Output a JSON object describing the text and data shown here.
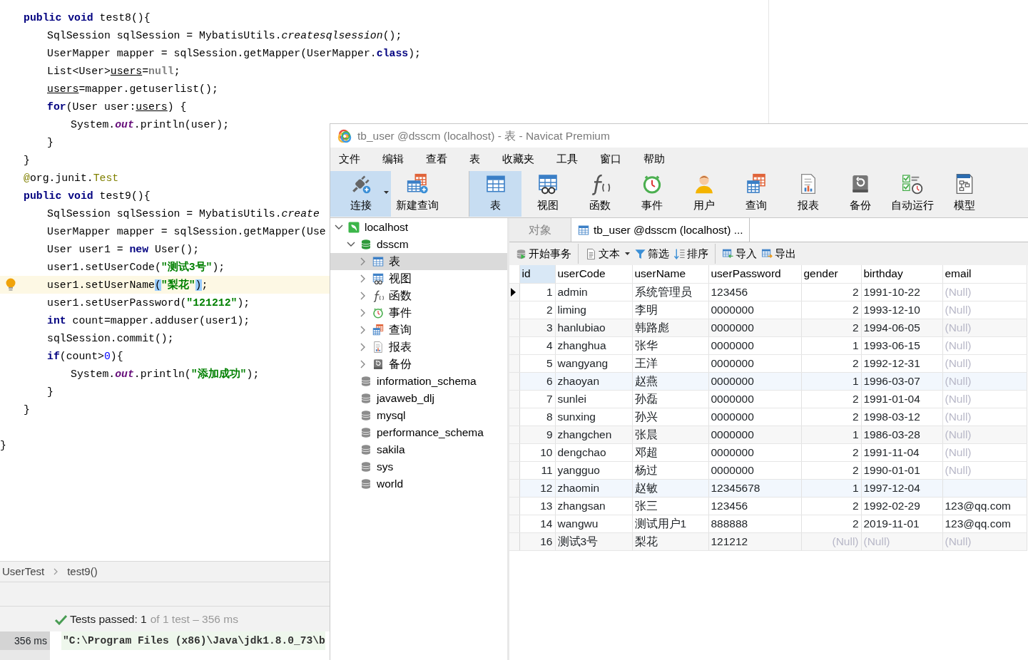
{
  "editor": {
    "lines": [
      {
        "children": [
          {
            "current": false,
            "tokens": [
              {
                "kind": "keyword",
                "text": "public void"
              },
              {
                "kind": "plain",
                "text": " test8(){"
              }
            ],
            "children": [
              {
                "current": false,
                "tokens": [
                  {
                    "kind": "plain",
                    "text": "SqlSession sqlSession = MybatisUtils."
                  },
                  {
                    "kind": "italic",
                    "text": "createsqlsession"
                  },
                  {
                    "kind": "plain",
                    "text": "();"
                  }
                ]
              },
              {
                "current": false,
                "tokens": [
                  {
                    "kind": "plain",
                    "text": "UserMapper mapper = sqlSession.getMapper(UserMapper."
                  },
                  {
                    "kind": "keyword",
                    "text": "class"
                  },
                  {
                    "kind": "plain",
                    "text": ");"
                  }
                ]
              },
              {
                "current": false,
                "tokens": [
                  {
                    "kind": "plain",
                    "text": "List<User>"
                  },
                  {
                    "kind": "var",
                    "text": "users"
                  },
                  {
                    "kind": "plain",
                    "text": "="
                  },
                  {
                    "kind": "null",
                    "text": "null"
                  },
                  {
                    "kind": "plain",
                    "text": ";"
                  }
                ]
              },
              {
                "current": false,
                "tokens": [
                  {
                    "kind": "var",
                    "text": "users"
                  },
                  {
                    "kind": "plain",
                    "text": "=mapper.getuserlist();"
                  }
                ]
              },
              {
                "current": false,
                "tokens": [
                  {
                    "kind": "keyword",
                    "text": "for"
                  },
                  {
                    "kind": "plain",
                    "text": "(User user:"
                  },
                  {
                    "kind": "var",
                    "text": "users"
                  },
                  {
                    "kind": "plain",
                    "text": ") {"
                  }
                ],
                "children": [
                  {
                    "current": false,
                    "tokens": [
                      {
                        "kind": "plain",
                        "text": "System."
                      },
                      {
                        "kind": "field",
                        "text": "out"
                      },
                      {
                        "kind": "plain",
                        "text": ".println(user);"
                      }
                    ]
                  }
                ]
              },
              {
                "current": false,
                "tokens": [
                  {
                    "kind": "plain",
                    "text": "}"
                  }
                ]
              }
            ]
          },
          {
            "current": false,
            "tokens": [
              {
                "kind": "plain",
                "text": "}"
              }
            ]
          },
          {
            "current": false,
            "tokens": [
              {
                "kind": "type",
                "text": "@"
              },
              {
                "kind": "plain",
                "text": "org.junit."
              },
              {
                "kind": "type",
                "text": "Test"
              }
            ]
          },
          {
            "current": false,
            "tokens": [
              {
                "kind": "keyword",
                "text": "public void"
              },
              {
                "kind": "plain",
                "text": " test9(){"
              }
            ],
            "children": [
              {
                "current": false,
                "tokens": [
                  {
                    "kind": "plain",
                    "text": "SqlSession sqlSession = MybatisUtils."
                  },
                  {
                    "kind": "italic",
                    "text": "create"
                  }
                ]
              },
              {
                "current": false,
                "tokens": [
                  {
                    "kind": "plain",
                    "text": "UserMapper mapper = sqlSession.getMapper(Use"
                  }
                ]
              },
              {
                "current": false,
                "tokens": [
                  {
                    "kind": "plain",
                    "text": "User user1 = "
                  },
                  {
                    "kind": "keyword",
                    "text": "new"
                  },
                  {
                    "kind": "plain",
                    "text": " User();"
                  }
                ]
              },
              {
                "current": false,
                "tokens": [
                  {
                    "kind": "plain",
                    "text": "user1.setUserCode("
                  },
                  {
                    "kind": "string",
                    "text": "\"测试3号\""
                  },
                  {
                    "kind": "plain",
                    "text": ");"
                  }
                ]
              },
              {
                "current": true,
                "tokens": [
                  {
                    "kind": "plain",
                    "text": "user1.setUserName"
                  },
                  {
                    "kind": "match",
                    "text": "("
                  },
                  {
                    "kind": "string",
                    "text": "\"梨花\""
                  },
                  {
                    "kind": "match",
                    "text": ")"
                  },
                  {
                    "kind": "plain",
                    "text": ";"
                  }
                ]
              },
              {
                "current": false,
                "tokens": [
                  {
                    "kind": "plain",
                    "text": "user1.setUserPassword("
                  },
                  {
                    "kind": "string",
                    "text": "\"121212\""
                  },
                  {
                    "kind": "plain",
                    "text": ");"
                  }
                ]
              },
              {
                "current": false,
                "tokens": [
                  {
                    "kind": "keyword",
                    "text": "int"
                  },
                  {
                    "kind": "plain",
                    "text": " count=mapper.adduser(user1);"
                  }
                ]
              },
              {
                "current": false,
                "tokens": [
                  {
                    "kind": "plain",
                    "text": "sqlSession.commit();"
                  }
                ]
              },
              {
                "current": false,
                "tokens": [
                  {
                    "kind": "keyword",
                    "text": "if"
                  },
                  {
                    "kind": "plain",
                    "text": "(count>"
                  },
                  {
                    "kind": "number",
                    "text": "0"
                  },
                  {
                    "kind": "plain",
                    "text": "){"
                  }
                ],
                "children": [
                  {
                    "current": false,
                    "tokens": [
                      {
                        "kind": "plain",
                        "text": "System."
                      },
                      {
                        "kind": "field",
                        "text": "out"
                      },
                      {
                        "kind": "plain",
                        "text": ".println("
                      },
                      {
                        "kind": "string",
                        "text": "\"添加成功\""
                      },
                      {
                        "kind": "plain",
                        "text": ");"
                      }
                    ]
                  }
                ]
              },
              {
                "current": false,
                "tokens": [
                  {
                    "kind": "plain",
                    "text": "}"
                  }
                ]
              }
            ]
          },
          {
            "current": false,
            "tokens": [
              {
                "kind": "plain",
                "text": "}"
              }
            ]
          }
        ]
      },
      {
        "current": false,
        "gap_before": true,
        "tokens": [
          {
            "kind": "plain",
            "text": "}"
          }
        ]
      }
    ]
  },
  "breadcrumbs": [
    "UserTest",
    "test9()"
  ],
  "test_status": {
    "passed": true,
    "summary": "Tests passed: 1",
    "detail": "of 1 test – 356 ms"
  },
  "console": {
    "duration": "356 ms",
    "output": "\"C:\\Program Files (x86)\\Java\\jdk1.8.0_73\\b"
  },
  "navicat": {
    "title": "tb_user @dsscm (localhost) - 表 - Navicat Premium",
    "menu": [
      "文件",
      "编辑",
      "查看",
      "表",
      "收藏夹",
      "工具",
      "窗口",
      "帮助"
    ],
    "toolbar": [
      {
        "kind": "connect",
        "label": "连接",
        "selected": true,
        "dropdown": true
      },
      {
        "kind": "new_query",
        "label": "新建查询",
        "selected": false
      },
      {
        "kind": "table",
        "label": "表",
        "selected": true,
        "separator_before": true
      },
      {
        "kind": "view",
        "label": "视图",
        "selected": false
      },
      {
        "kind": "function",
        "label": "函数",
        "selected": false
      },
      {
        "kind": "event",
        "label": "事件",
        "selected": false
      },
      {
        "kind": "user",
        "label": "用户",
        "selected": false
      },
      {
        "kind": "query",
        "label": "查询",
        "selected": false
      },
      {
        "kind": "report",
        "label": "报表",
        "selected": false
      },
      {
        "kind": "backup",
        "label": "备份",
        "selected": false
      },
      {
        "kind": "automation",
        "label": "自动运行",
        "selected": false
      },
      {
        "kind": "model",
        "label": "模型",
        "selected": false
      }
    ],
    "tree": [
      {
        "kind": "server",
        "label": "localhost",
        "expanded": true,
        "selected": false,
        "children": [
          {
            "kind": "database_open",
            "label": "dsscm",
            "expanded": true,
            "selected": false,
            "children": [
              {
                "kind": "table",
                "label": "表",
                "expanded": false,
                "selected": true
              },
              {
                "kind": "view",
                "label": "视图",
                "expanded": false,
                "selected": false
              },
              {
                "kind": "function",
                "label": "函数",
                "expanded": false,
                "selected": false
              },
              {
                "kind": "event",
                "label": "事件",
                "expanded": false,
                "selected": false
              },
              {
                "kind": "query",
                "label": "查询",
                "expanded": false,
                "selected": false
              },
              {
                "kind": "report",
                "label": "报表",
                "expanded": false,
                "selected": false
              },
              {
                "kind": "backup",
                "label": "备份",
                "expanded": false,
                "selected": false
              }
            ]
          },
          {
            "kind": "database",
            "label": "information_schema",
            "selected": false
          },
          {
            "kind": "database",
            "label": "javaweb_dlj",
            "selected": false
          },
          {
            "kind": "database",
            "label": "mysql",
            "selected": false
          },
          {
            "kind": "database",
            "label": "performance_schema",
            "selected": false
          },
          {
            "kind": "database",
            "label": "sakila",
            "selected": false
          },
          {
            "kind": "database",
            "label": "sys",
            "selected": false
          },
          {
            "kind": "database",
            "label": "world",
            "selected": false
          }
        ]
      }
    ],
    "tabs": [
      {
        "kind": "objects",
        "label": "对象",
        "selected": false
      },
      {
        "kind": "table",
        "label": "tb_user @dsscm (localhost) ...",
        "selected": true
      }
    ],
    "table_toolbar": [
      {
        "kind": "transaction",
        "label": "开始事务"
      },
      {
        "kind": "text",
        "label": "文本",
        "dropdown": true,
        "separator_before": true
      },
      {
        "kind": "filter",
        "label": "筛选"
      },
      {
        "kind": "sort",
        "label": "排序"
      },
      {
        "kind": "import",
        "label": "导入",
        "separator_before": true
      },
      {
        "kind": "export",
        "label": "导出"
      }
    ],
    "table": {
      "columns": [
        "id",
        "userCode",
        "userName",
        "userPassword",
        "gender",
        "birthday",
        "email"
      ],
      "rows": [
        {
          "current": true,
          "cells": [
            "1",
            "admin",
            "系统管理员",
            "123456",
            "2",
            "1991-10-22",
            {
              "text": "(Null)",
              "null": true
            }
          ]
        },
        {
          "current": false,
          "cells": [
            "2",
            "liming",
            "李明",
            "0000000",
            "2",
            "1993-12-10",
            {
              "text": "(Null)",
              "null": true
            }
          ]
        },
        {
          "current": false,
          "cells": [
            "3",
            "hanlubiao",
            "韩路彪",
            "0000000",
            "2",
            "1994-06-05",
            {
              "text": "(Null)",
              "null": true
            }
          ]
        },
        {
          "current": false,
          "cells": [
            "4",
            "zhanghua",
            "张华",
            "0000000",
            "1",
            "1993-06-15",
            {
              "text": "(Null)",
              "null": true
            }
          ]
        },
        {
          "current": false,
          "cells": [
            "5",
            "wangyang",
            "王洋",
            "0000000",
            "2",
            "1992-12-31",
            {
              "text": "(Null)",
              "null": true
            }
          ]
        },
        {
          "current": false,
          "cells": [
            "6",
            "zhaoyan",
            "赵燕",
            "0000000",
            "1",
            "1996-03-07",
            {
              "text": "(Null)",
              "null": true
            }
          ]
        },
        {
          "current": false,
          "cells": [
            "7",
            "sunlei",
            "孙磊",
            "0000000",
            "2",
            "1991-01-04",
            {
              "text": "(Null)",
              "null": true
            }
          ]
        },
        {
          "current": false,
          "cells": [
            "8",
            "sunxing",
            "孙兴",
            "0000000",
            "2",
            "1998-03-12",
            {
              "text": "(Null)",
              "null": true
            }
          ]
        },
        {
          "current": false,
          "cells": [
            "9",
            "zhangchen",
            "张晨",
            "0000000",
            "1",
            "1986-03-28",
            {
              "text": "(Null)",
              "null": true
            }
          ]
        },
        {
          "current": false,
          "cells": [
            "10",
            "dengchao",
            "邓超",
            "0000000",
            "2",
            "1991-11-04",
            {
              "text": "(Null)",
              "null": true
            }
          ]
        },
        {
          "current": false,
          "cells": [
            "11",
            "yangguo",
            "杨过",
            "0000000",
            "2",
            "1990-01-01",
            {
              "text": "(Null)",
              "null": true
            }
          ]
        },
        {
          "current": false,
          "cells": [
            "12",
            "zhaomin",
            "赵敏",
            "12345678",
            "1",
            "1997-12-04",
            null
          ]
        },
        {
          "current": false,
          "cells": [
            "13",
            "zhangsan",
            "张三",
            "123456",
            "2",
            "1992-02-29",
            "123@qq.com"
          ]
        },
        {
          "current": false,
          "cells": [
            "14",
            "wangwu",
            "测试用户1",
            "888888",
            "2",
            "2019-11-01",
            "123@qq.com"
          ]
        },
        {
          "current": false,
          "cells": [
            "16",
            "测试3号",
            "梨花",
            "121212",
            {
              "text": "(Null)",
              "null": true
            },
            {
              "text": "(Null)",
              "null": true
            },
            {
              "text": "(Null)",
              "null": true
            }
          ]
        }
      ]
    }
  }
}
